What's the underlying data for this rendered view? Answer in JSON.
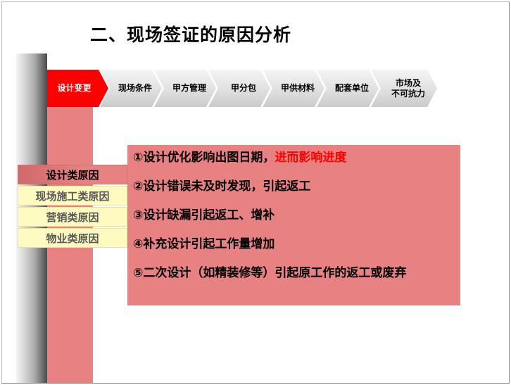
{
  "title": "二、现场签证的原因分析",
  "steps": [
    {
      "label": "设计变更"
    },
    {
      "label": "现场条件"
    },
    {
      "label": "甲方管理"
    },
    {
      "label": "甲分包"
    },
    {
      "label": "甲供材料"
    },
    {
      "label": "配套单位"
    },
    {
      "label": "市场及\n不可抗力"
    }
  ],
  "causes": [
    {
      "label": "设计类原因",
      "active": true
    },
    {
      "label": "现场施工类原因",
      "active": false
    },
    {
      "label": "营销类原因",
      "active": false
    },
    {
      "label": "物业类原因",
      "active": false
    }
  ],
  "reasons": {
    "r1_main": "①设计优化影响出图日期，",
    "r1_highlight": "进而影响进度",
    "r2": "②设计错误未及时发现，引起返工",
    "r3": "③设计缺漏引起返工、增补",
    "r4": "④补充设计引起工作量增加",
    "r5": "⑤二次设计（如精装修等）引起原工作的返工或废弃"
  },
  "colors": {
    "active_step": "#ff0000",
    "panel": "#e88282",
    "cause_bg": "#fefac0",
    "highlight_text": "#ff0000"
  }
}
